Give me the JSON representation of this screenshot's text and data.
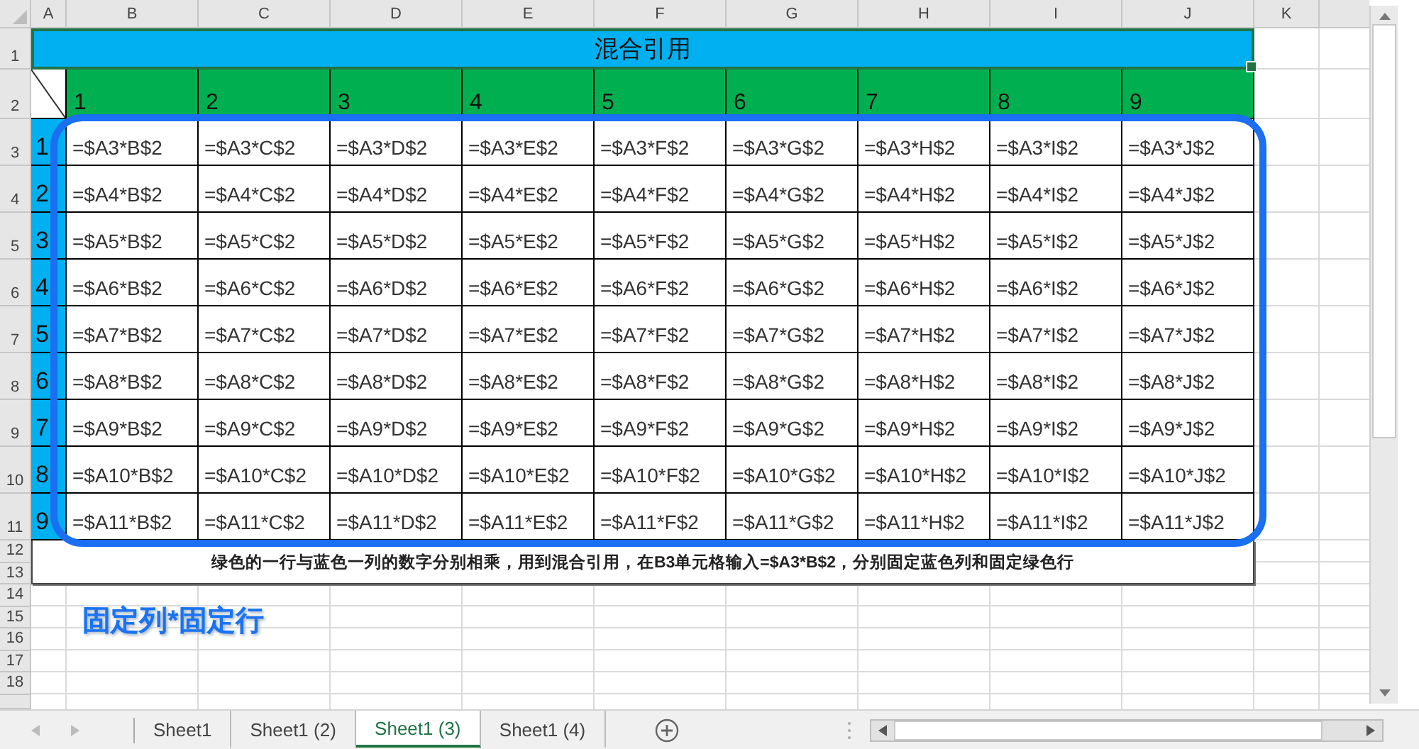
{
  "column_headers": [
    "A",
    "B",
    "C",
    "D",
    "E",
    "F",
    "G",
    "H",
    "I",
    "J",
    "K"
  ],
  "row_headers": [
    "1",
    "2",
    "3",
    "4",
    "5",
    "6",
    "7",
    "8",
    "9",
    "10",
    "11",
    "12",
    "13",
    "14",
    "15",
    "16",
    "17",
    "18"
  ],
  "title": "混合引用",
  "green_row": [
    "1",
    "2",
    "3",
    "4",
    "5",
    "6",
    "7",
    "8",
    "9"
  ],
  "rows": [
    {
      "label": "1",
      "cells": [
        "=$A3*B$2",
        "=$A3*C$2",
        "=$A3*D$2",
        "=$A3*E$2",
        "=$A3*F$2",
        "=$A3*G$2",
        "=$A3*H$2",
        "=$A3*I$2",
        "=$A3*J$2"
      ]
    },
    {
      "label": "2",
      "cells": [
        "=$A4*B$2",
        "=$A4*C$2",
        "=$A4*D$2",
        "=$A4*E$2",
        "=$A4*F$2",
        "=$A4*G$2",
        "=$A4*H$2",
        "=$A4*I$2",
        "=$A4*J$2"
      ]
    },
    {
      "label": "3",
      "cells": [
        "=$A5*B$2",
        "=$A5*C$2",
        "=$A5*D$2",
        "=$A5*E$2",
        "=$A5*F$2",
        "=$A5*G$2",
        "=$A5*H$2",
        "=$A5*I$2",
        "=$A5*J$2"
      ]
    },
    {
      "label": "4",
      "cells": [
        "=$A6*B$2",
        "=$A6*C$2",
        "=$A6*D$2",
        "=$A6*E$2",
        "=$A6*F$2",
        "=$A6*G$2",
        "=$A6*H$2",
        "=$A6*I$2",
        "=$A6*J$2"
      ]
    },
    {
      "label": "5",
      "cells": [
        "=$A7*B$2",
        "=$A7*C$2",
        "=$A7*D$2",
        "=$A7*E$2",
        "=$A7*F$2",
        "=$A7*G$2",
        "=$A7*H$2",
        "=$A7*I$2",
        "=$A7*J$2"
      ]
    },
    {
      "label": "6",
      "cells": [
        "=$A8*B$2",
        "=$A8*C$2",
        "=$A8*D$2",
        "=$A8*E$2",
        "=$A8*F$2",
        "=$A8*G$2",
        "=$A8*H$2",
        "=$A8*I$2",
        "=$A8*J$2"
      ]
    },
    {
      "label": "7",
      "cells": [
        "=$A9*B$2",
        "=$A9*C$2",
        "=$A9*D$2",
        "=$A9*E$2",
        "=$A9*F$2",
        "=$A9*G$2",
        "=$A9*H$2",
        "=$A9*I$2",
        "=$A9*J$2"
      ]
    },
    {
      "label": "8",
      "cells": [
        "=$A10*B$2",
        "=$A10*C$2",
        "=$A10*D$2",
        "=$A10*E$2",
        "=$A10*F$2",
        "=$A10*G$2",
        "=$A10*H$2",
        "=$A10*I$2",
        "=$A10*J$2"
      ]
    },
    {
      "label": "9",
      "cells": [
        "=$A11*B$2",
        "=$A11*C$2",
        "=$A11*D$2",
        "=$A11*E$2",
        "=$A11*F$2",
        "=$A11*G$2",
        "=$A11*H$2",
        "=$A11*I$2",
        "=$A11*J$2"
      ]
    }
  ],
  "note": "绿色的一行与蓝色一列的数字分别相乘，用到混合引用，在B3单元格输入=$A3*B$2，分别固定蓝色列和固定绿色行",
  "annotation": "固定列*固定行",
  "sheet_tabs": [
    {
      "label": "Sheet1",
      "selected": false
    },
    {
      "label": "Sheet1 (2)",
      "selected": false
    },
    {
      "label": "Sheet1 (3)",
      "selected": true
    },
    {
      "label": "Sheet1 (4)",
      "selected": false
    }
  ]
}
